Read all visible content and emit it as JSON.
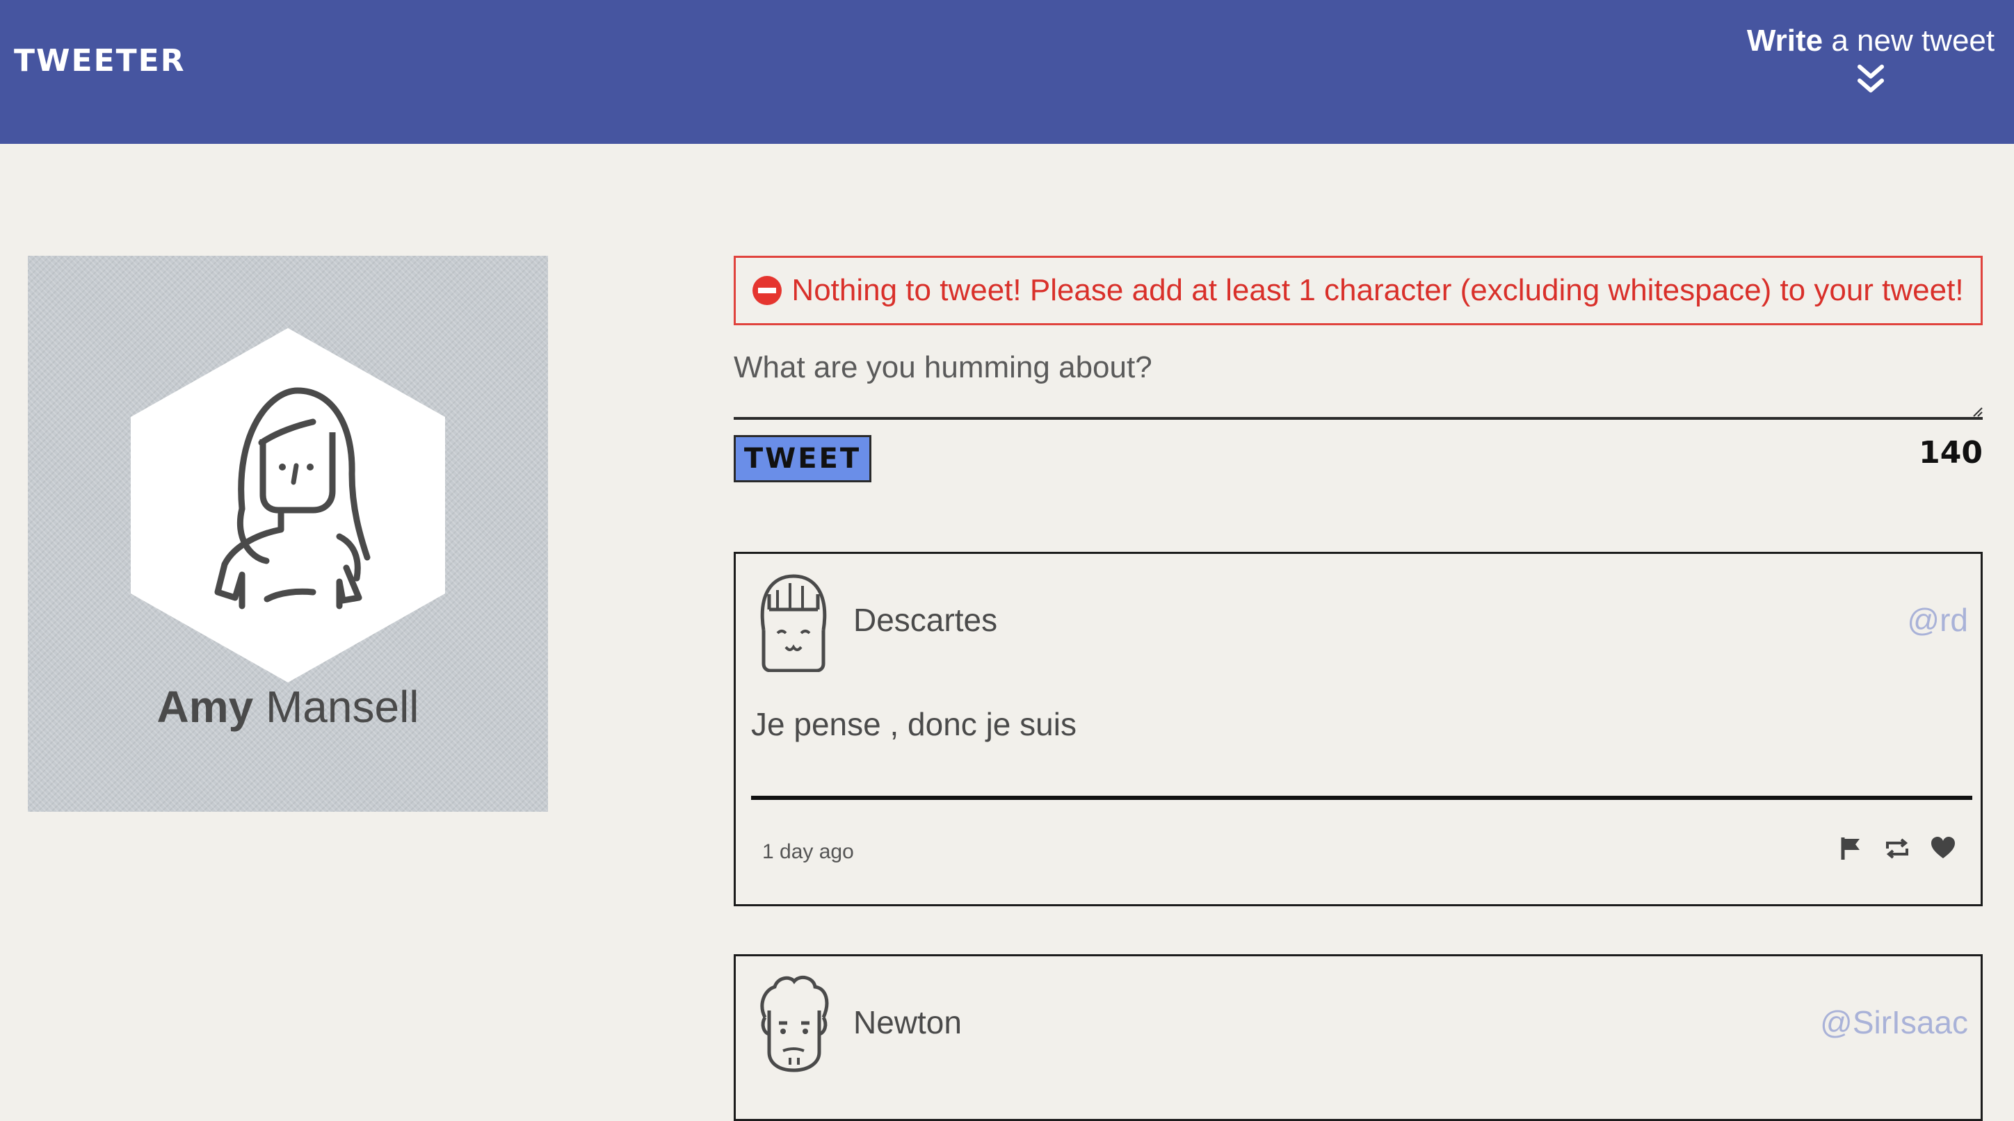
{
  "nav": {
    "brand": "TWEETER",
    "compose_bold": "Write",
    "compose_rest": " a new tweet",
    "compose_icon": "double-chevron-down-icon",
    "background_color": "#4655a0"
  },
  "profile": {
    "first_name": "Amy",
    "last_name": "Mansell",
    "avatar_icon": "user-avatar-icon"
  },
  "composer": {
    "error_icon": "no-entry-icon",
    "error_message": "Nothing to tweet! Please add at least 1 character (excluding whitespace) to your tweet!",
    "placeholder": "What are you humming about?",
    "tweet_button_label": "TWEET",
    "char_counter": "140",
    "accent_color": "#6a8ee8",
    "error_color": "#d9302a"
  },
  "tweets": [
    {
      "author": "Descartes",
      "handle": "@rd",
      "content": "Je pense , donc je suis",
      "timestamp": "1 day ago",
      "actions": [
        "flag-icon",
        "retweet-icon",
        "heart-icon"
      ]
    },
    {
      "author": "Newton",
      "handle": "@SirIsaac"
    }
  ],
  "colors": {
    "page_background": "#f2f0eb",
    "handle_color": "#a9b2d8"
  }
}
